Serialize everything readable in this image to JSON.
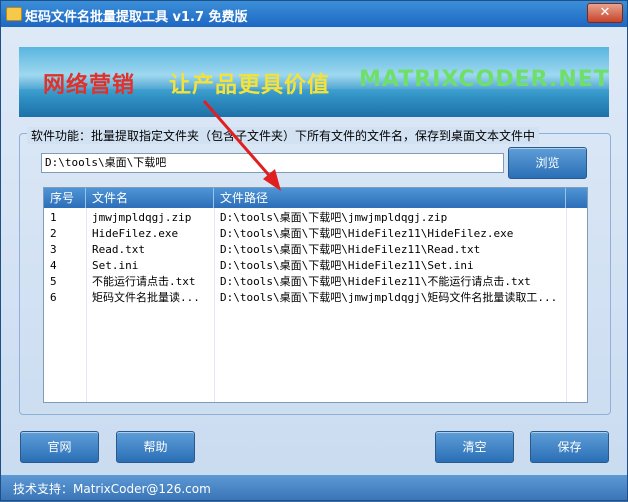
{
  "window": {
    "title": "矩码文件名批量提取工具 v1.7 免费版",
    "close_glyph": "✕"
  },
  "banner": {
    "text1": "网络营销",
    "text2": "让产品更具价值",
    "text3": "MATRIXCODER.NET"
  },
  "feature_label": "软件功能：批量提取指定文件夹（包含子文件夹）下所有文件的文件名，保存到桌面文本文件中",
  "path_input": {
    "value": "D:\\tools\\桌面\\下载吧"
  },
  "browse_label": "浏览",
  "table": {
    "headers": [
      "序号",
      "文件名",
      "文件路径"
    ],
    "rows": [
      {
        "num": "1",
        "name": "jmwjmpldqgj.zip",
        "path": "D:\\tools\\桌面\\下载吧\\jmwjmpldqgj.zip"
      },
      {
        "num": "2",
        "name": "HideFilez.exe",
        "path": "D:\\tools\\桌面\\下载吧\\HideFilez11\\HideFilez.exe"
      },
      {
        "num": "3",
        "name": "Read.txt",
        "path": "D:\\tools\\桌面\\下载吧\\HideFilez11\\Read.txt"
      },
      {
        "num": "4",
        "name": "Set.ini",
        "path": "D:\\tools\\桌面\\下载吧\\HideFilez11\\Set.ini"
      },
      {
        "num": "5",
        "name": "不能运行请点击.txt",
        "path": "D:\\tools\\桌面\\下载吧\\HideFilez11\\不能运行请点击.txt"
      },
      {
        "num": "6",
        "name": "矩码文件名批量读...",
        "path": "D:\\tools\\桌面\\下载吧\\jmwjmpldqgj\\矩码文件名批量读取工..."
      }
    ]
  },
  "buttons": {
    "site": "官网",
    "help": "帮助",
    "clear": "清空",
    "save": "保存"
  },
  "status": {
    "text": "技术支持：MatrixCoder@126.com"
  },
  "colors": {
    "accent": "#2a6fb6",
    "arrow": "#e02020"
  }
}
